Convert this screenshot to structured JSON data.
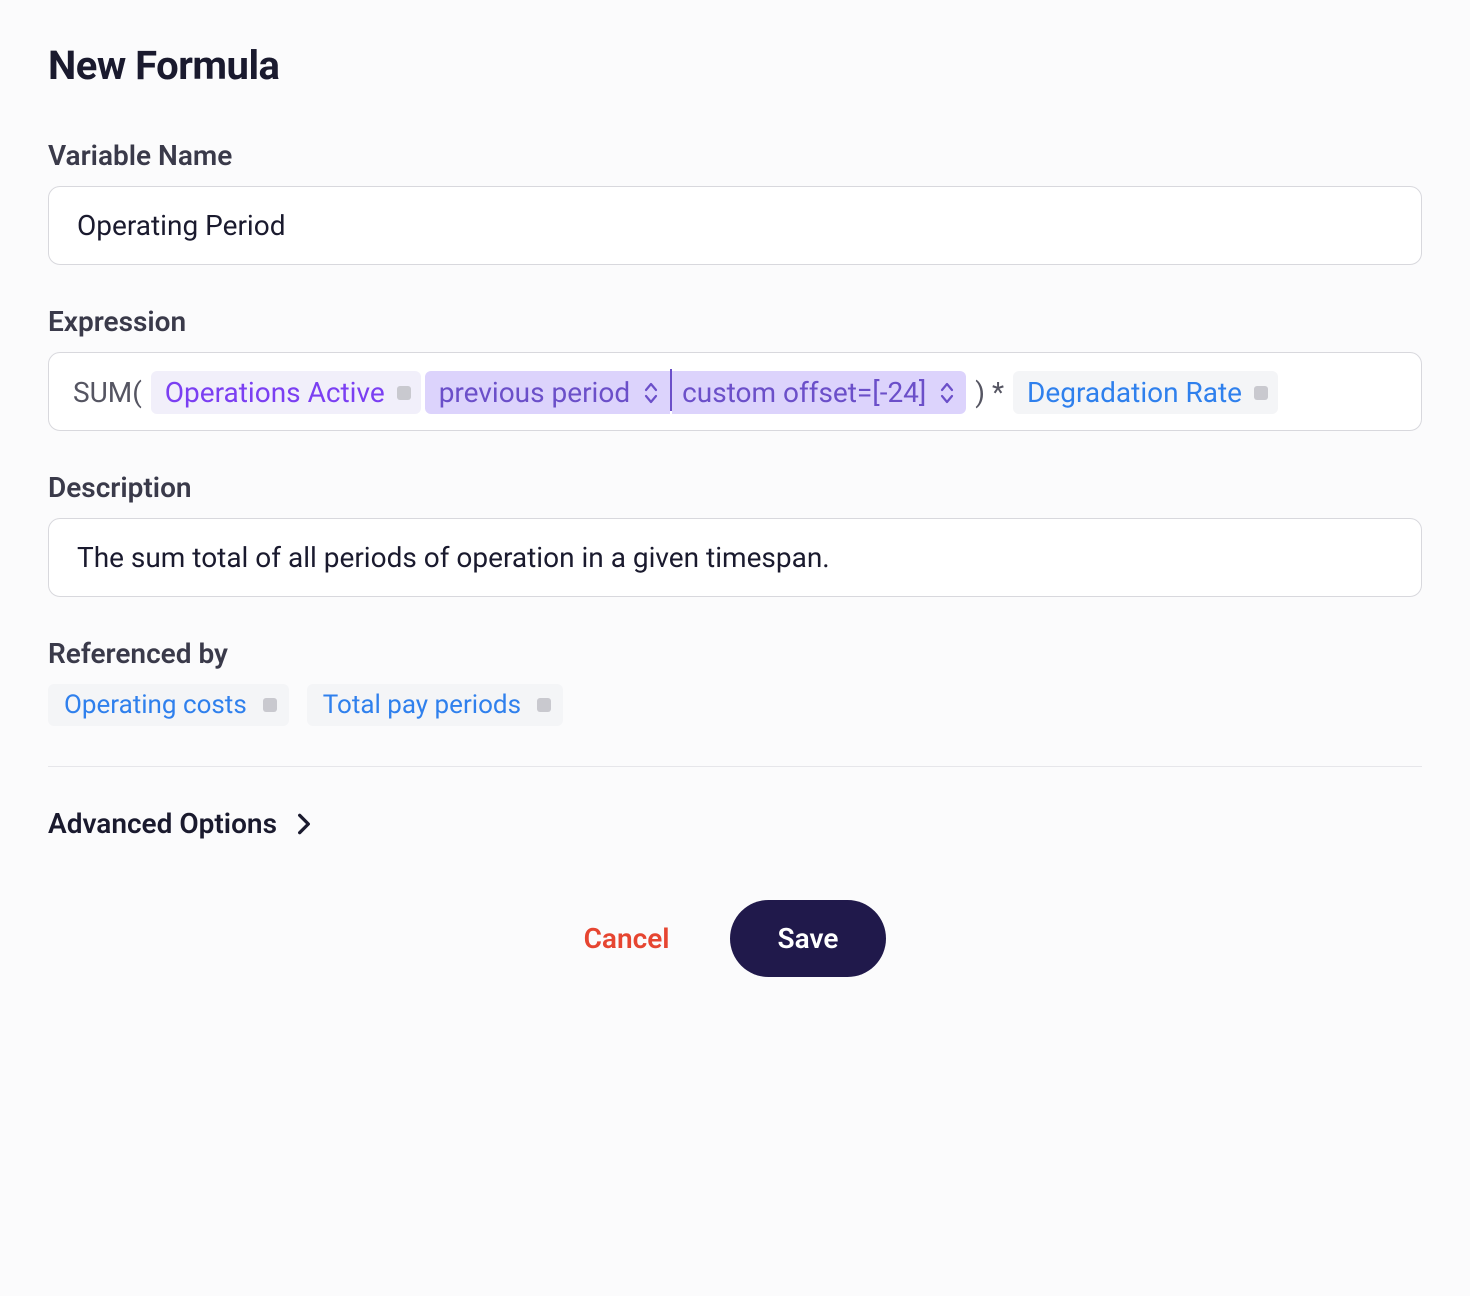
{
  "title": "New Formula",
  "fields": {
    "variableName": {
      "label": "Variable Name",
      "value": "Operating Period"
    },
    "expression": {
      "label": "Expression",
      "tokens": {
        "fn_open": "SUM( ",
        "operations_active": "Operations Active",
        "previous_period": "previous period",
        "custom_offset": "custom offset=[-24]",
        "close_mul": " ) * ",
        "degradation_rate": "Degradation Rate"
      }
    },
    "description": {
      "label": "Description",
      "value": "The sum total of all periods of operation in a given timespan."
    },
    "referencedBy": {
      "label": "Referenced by",
      "items": [
        "Operating costs",
        "Total pay periods"
      ]
    }
  },
  "advancedOptions": "Advanced Options",
  "actions": {
    "cancel": "Cancel",
    "save": "Save"
  }
}
